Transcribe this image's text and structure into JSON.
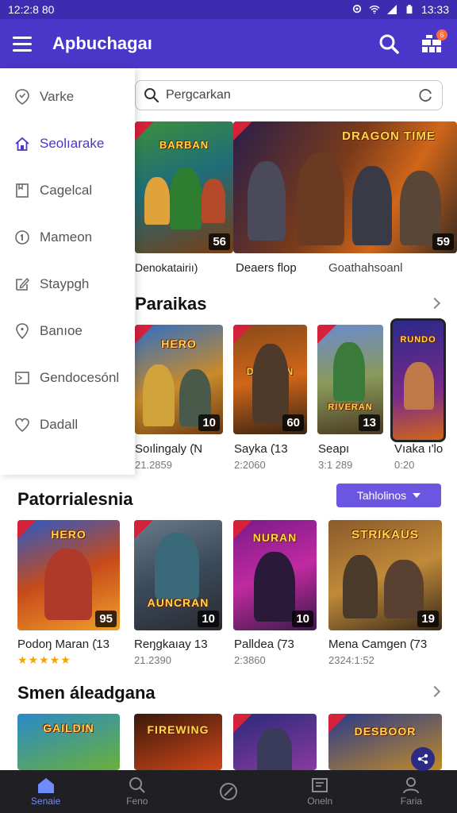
{
  "status_bar": {
    "time": "12:2:8 80",
    "right_time": "13:33"
  },
  "app_bar": {
    "title": "Apbuchagaı",
    "cart_badge": "6"
  },
  "search": {
    "placeholder": "Pergcarkan"
  },
  "drawer": {
    "items": [
      {
        "label": "Varke",
        "icon": "location-icon"
      },
      {
        "label": "Seolıarake",
        "icon": "home-icon"
      },
      {
        "label": "Cagelcal",
        "icon": "bookmark-icon"
      },
      {
        "label": "Mameon",
        "icon": "info-icon"
      },
      {
        "label": "Staypgh",
        "icon": "edit-icon"
      },
      {
        "label": "Banıoe",
        "icon": "pin-icon"
      },
      {
        "label": "Gendocesónl",
        "icon": "image-icon"
      },
      {
        "label": "Dadall",
        "icon": "heart-icon"
      }
    ]
  },
  "featured": {
    "captions": [
      "Denokatairiı)",
      "Deaers flop",
      "Goathahsoanl"
    ],
    "tiles": [
      {
        "art_title": "BARBAN",
        "number": "56"
      },
      {
        "art_title": "DRAGON TIME",
        "number": "59"
      }
    ]
  },
  "section1": {
    "title": "Paraikas",
    "items": [
      {
        "art": "HERO",
        "number": "10",
        "name": "Soılingaly (̇N",
        "meta": "21.2859"
      },
      {
        "art": "DRAGON",
        "number": "60",
        "name": "Sayka (̇13",
        "meta": "2:2060"
      },
      {
        "art": "RIVERAN",
        "number": "13",
        "name": "Seapı",
        "meta": "3:1 289"
      },
      {
        "art": "RUNDO",
        "number": "",
        "name": "Vıaka ı'lo",
        "meta": "0:20"
      }
    ]
  },
  "section2": {
    "title": "Patorrialesnia",
    "filter_label": "Tahlolinos",
    "items": [
      {
        "art": "HERO",
        "number": "95",
        "name": "Podoŋ Maran (̇13",
        "meta": "",
        "stars": "★★★★★"
      },
      {
        "art": "AUNCRAN",
        "number": "10",
        "name": "Reŋgkaıay 13",
        "meta": "21.2390"
      },
      {
        "art": "NURAN",
        "number": "10",
        "name": "Palldea (̇73",
        "meta": "2:3860"
      },
      {
        "art": "STRIKAUS",
        "number": "19",
        "name": "Mena Camgen (̇73",
        "meta": "2324:1:52"
      }
    ]
  },
  "section3": {
    "title": "Smen áleadgana",
    "items": [
      {
        "art": "GAILDIN"
      },
      {
        "art": "FIREWING"
      },
      {
        "art": ""
      },
      {
        "art": "DESBOOR"
      }
    ]
  },
  "bottom_nav": [
    {
      "label": "Senaie",
      "icon": "home-icon"
    },
    {
      "label": "Feno",
      "icon": "search-icon"
    },
    {
      "label": "",
      "icon": "leaf-icon"
    },
    {
      "label": "Oneln",
      "icon": "library-icon"
    },
    {
      "label": "Faria",
      "icon": "profile-icon"
    }
  ],
  "colors": {
    "primary": "#4a36c9",
    "status_bar": "#3d2bb0",
    "accent": "#6a56e0",
    "nav_active": "#6f8cff"
  }
}
